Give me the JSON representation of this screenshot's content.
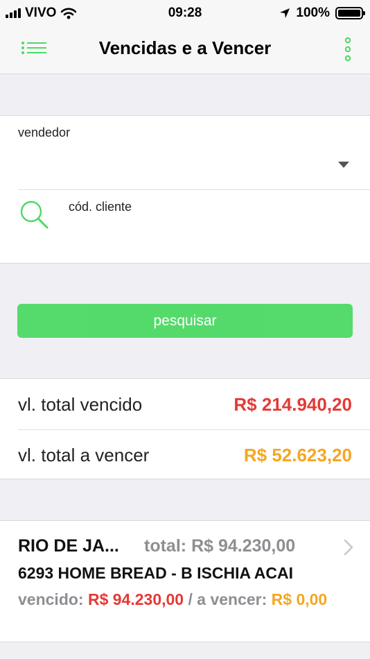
{
  "status_bar": {
    "carrier": "VIVO",
    "time": "09:28",
    "battery": "100%",
    "battery_level": 1.0
  },
  "nav": {
    "title": "Vencidas e a Vencer",
    "menu_icon": "list-icon",
    "more_icon": "vertical-dots-icon"
  },
  "filters": {
    "vendedor_label": "vendedor",
    "cliente_label": "cód. cliente"
  },
  "actions": {
    "search_label": "pesquisar"
  },
  "totals": {
    "vencido_label": "vl. total vencido",
    "vencido_value": "R$ 214.940,20",
    "a_vencer_label": "vl. total a vencer",
    "a_vencer_value": "R$ 52.623,20"
  },
  "results": [
    {
      "city": "RIO DE JA...",
      "total_label": "total:",
      "total_value": "R$ 94.230,00",
      "name": "6293 HOME BREAD - B ISCHIA ACAI",
      "vencido_label": "vencido:",
      "vencido_value": "R$ 94.230,00",
      "separator": "/",
      "a_vencer_label": "a vencer:",
      "a_vencer_value": "R$ 0,00"
    }
  ],
  "colors": {
    "accent_green": "#4cd964",
    "overdue_red": "#e53935",
    "upcoming_orange": "#f5a623",
    "muted_gray": "#8e8e93"
  }
}
